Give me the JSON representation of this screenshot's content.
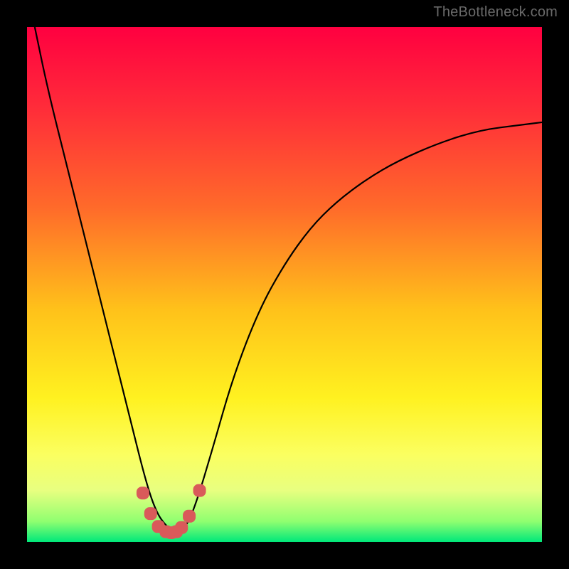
{
  "watermark": "TheBottleneck.com",
  "chart_data": {
    "type": "line",
    "title": "",
    "xlabel": "",
    "ylabel": "",
    "xlim": [
      0,
      1
    ],
    "ylim": [
      0,
      1
    ],
    "grid": false,
    "legend": false,
    "gradient_stops": [
      {
        "offset": 0.0,
        "color": "#ff0040"
      },
      {
        "offset": 0.15,
        "color": "#ff2a3a"
      },
      {
        "offset": 0.35,
        "color": "#ff6a2a"
      },
      {
        "offset": 0.55,
        "color": "#ffc21a"
      },
      {
        "offset": 0.72,
        "color": "#fff120"
      },
      {
        "offset": 0.83,
        "color": "#fbff60"
      },
      {
        "offset": 0.9,
        "color": "#e8ff80"
      },
      {
        "offset": 0.96,
        "color": "#90ff70"
      },
      {
        "offset": 1.0,
        "color": "#00e87a"
      }
    ],
    "series": [
      {
        "name": "bottleneck-curve",
        "color": "#000000",
        "width": 2.2,
        "x": [
          0.015,
          0.04,
          0.08,
          0.12,
          0.16,
          0.2,
          0.23,
          0.25,
          0.27,
          0.29,
          0.31,
          0.33,
          0.36,
          0.4,
          0.45,
          0.5,
          0.55,
          0.6,
          0.66,
          0.72,
          0.8,
          0.88,
          0.96,
          1.0
        ],
        "y": [
          1.0,
          0.88,
          0.72,
          0.56,
          0.4,
          0.24,
          0.12,
          0.06,
          0.03,
          0.02,
          0.03,
          0.08,
          0.18,
          0.32,
          0.45,
          0.54,
          0.61,
          0.66,
          0.705,
          0.74,
          0.775,
          0.8,
          0.81,
          0.815
        ]
      },
      {
        "name": "marker-band",
        "type": "marker",
        "marker_shape": "rounded-square",
        "color": "#d95a5a",
        "size": 18,
        "x": [
          0.225,
          0.24,
          0.255,
          0.27,
          0.28,
          0.29,
          0.3,
          0.315,
          0.335
        ],
        "y": [
          0.095,
          0.055,
          0.03,
          0.02,
          0.018,
          0.02,
          0.028,
          0.05,
          0.1
        ]
      }
    ]
  }
}
